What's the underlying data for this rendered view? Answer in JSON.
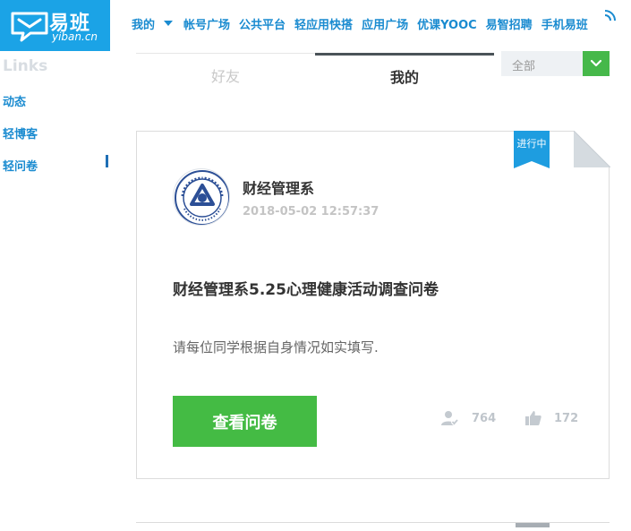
{
  "logo": {
    "name": "易班",
    "sub": "yiban.cn",
    "icon": "yiban-logo-icon"
  },
  "nav": {
    "items": [
      {
        "label": "我的",
        "has_dropdown": true
      },
      {
        "label": "帐号广场"
      },
      {
        "label": "公共平台"
      },
      {
        "label": "轻应用快搭"
      },
      {
        "label": "应用广场"
      },
      {
        "label": "优课YOOC"
      },
      {
        "label": "易智招聘"
      },
      {
        "label": "手机易班"
      }
    ],
    "mobile_icon": "wifi-icon"
  },
  "sidebar": {
    "title": "Links",
    "items": [
      {
        "label": "动态"
      },
      {
        "label": "轻博客"
      },
      {
        "label": "轻问卷",
        "active": true
      }
    ]
  },
  "tabs": [
    {
      "label": "好友",
      "active": false
    },
    {
      "label": "我的",
      "active": true
    }
  ],
  "filter": {
    "value": "全部",
    "button_icon": "chevron-down-icon"
  },
  "card": {
    "status": "进行中",
    "org_name": "财经管理系",
    "time": "2018-05-02 12:57:37",
    "title": "财经管理系5.25心理健康活动调查问卷",
    "description": "请每位同学根据自身情况如实填写.",
    "button_label": "查看问卷",
    "participants": "764",
    "likes": "172"
  },
  "colors": {
    "brand_blue": "#1ba3e6",
    "nav_blue": "#1a8bd0",
    "green": "#44bb44",
    "tag_blue": "#1e9de0"
  }
}
